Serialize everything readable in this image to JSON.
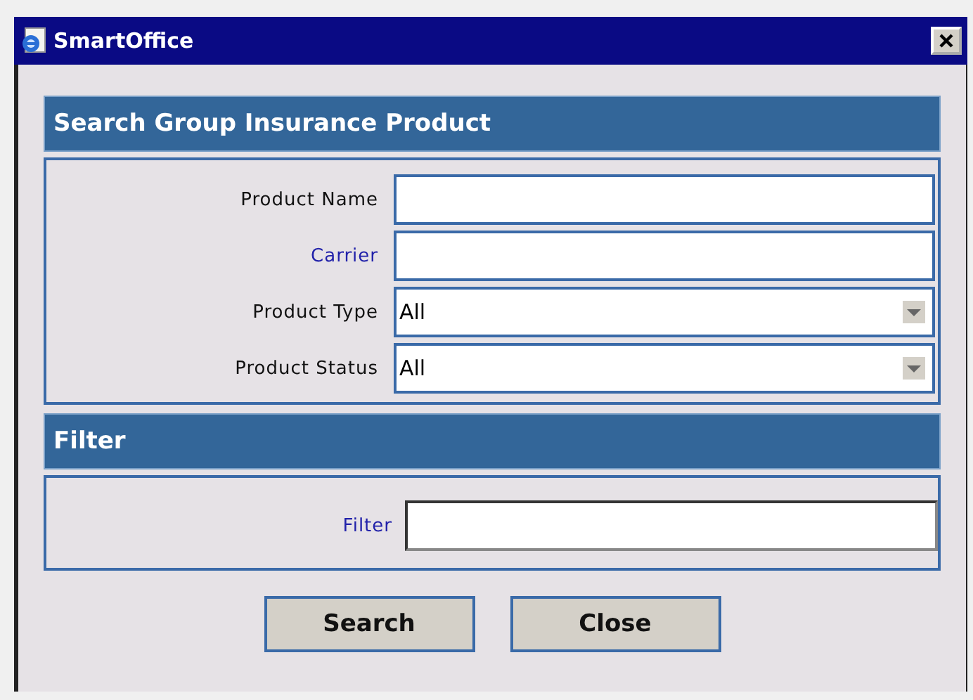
{
  "window": {
    "title": "SmartOffice"
  },
  "search_section": {
    "title": "Search Group Insurance Product",
    "fields": [
      {
        "label": {
          "text": "Product Name",
          "kind": "plain"
        },
        "kind": "text"
      },
      {
        "label": {
          "text": "Carrier",
          "kind": "link"
        },
        "kind": "text"
      },
      {
        "label": {
          "text": "Product Type",
          "kind": "plain"
        },
        "kind": "select",
        "value": "All"
      },
      {
        "label": {
          "text": "Product Status",
          "kind": "plain"
        },
        "kind": "select",
        "value": "All"
      }
    ]
  },
  "filter_section": {
    "title": "Filter",
    "label": {
      "text": "Filter",
      "kind": "link"
    }
  },
  "buttons": [
    "Search",
    "Close"
  ]
}
